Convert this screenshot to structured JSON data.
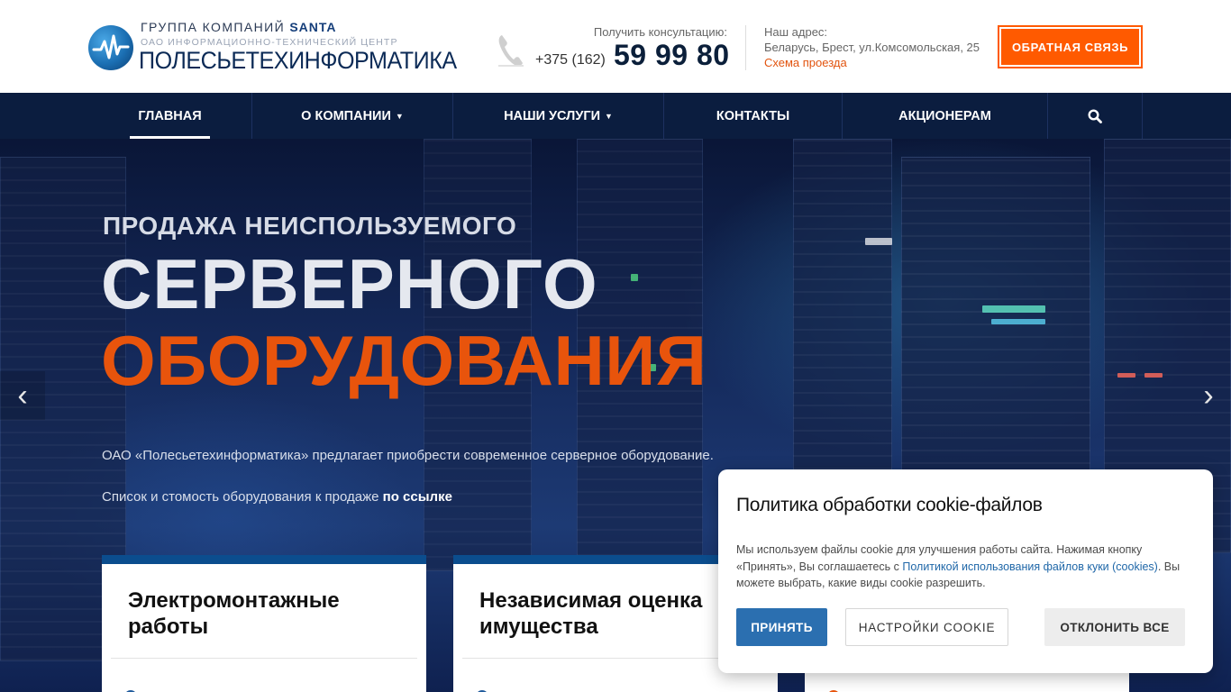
{
  "header": {
    "logo_group_prefix": "ГРУППА КОМПАНИЙ",
    "logo_group_brand": "SANTA",
    "logo_subtitle": "ОАО ИНФОРМАЦИОННО-ТЕХНИЧЕСКИЙ ЦЕНТР",
    "logo_name": "ПОЛЕСЬЕТЕХИНФОРМАТИКА",
    "consult_label": "Получить консультацию:",
    "phone_prefix": "+375 (162)",
    "phone_main": "59 99 80",
    "address_label": "Наш адрес:",
    "address_text": "Беларусь, Брест, ул.Комсомольская, 25",
    "address_link": "Схема проезда",
    "feedback_button": "ОБРАТНАЯ СВЯЗЬ"
  },
  "nav": {
    "items": [
      {
        "label": "ГЛАВНАЯ",
        "active": true
      },
      {
        "label": "О КОМПАНИИ",
        "dropdown": true
      },
      {
        "label": "НАШИ УСЛУГИ",
        "dropdown": true
      },
      {
        "label": "КОНТАКТЫ"
      },
      {
        "label": "АКЦИОНЕРАМ"
      }
    ],
    "search_icon": "search-icon"
  },
  "hero": {
    "line1": "ПРОДАЖА НЕИСПОЛЬЗУЕМОГО",
    "line2": "СЕРВЕРНОГО",
    "line3": "ОБОРУДОВАНИЯ",
    "paragraph1": "ОАО «Полесьетехинформатика» предлагает приобрести современное серверное оборудование.",
    "paragraph2_text": "Список и стомость оборудования к продаже ",
    "paragraph2_link": "по ссылке"
  },
  "cards": [
    {
      "title_line1": "Электромонтажные",
      "title_line2": "работы"
    },
    {
      "title_line1": "Независимая оценка",
      "title_line2": "имущества"
    },
    {
      "title_line1": "",
      "title_line2": ""
    }
  ],
  "cookie": {
    "title": "Политика обработки cookie-файлов",
    "text_before_link": "Мы используем файлы cookie для улучшения работы сайта. Нажимая кнопку «Принять», Вы соглашаетесь с ",
    "link": "Политикой использования файлов куки (cookies)",
    "text_after_link": ". Вы можете выбрать, какие виды cookie разрешить.",
    "accept": "ПРИНЯТЬ",
    "settings": "НАСТРОЙКИ COOKIE",
    "decline": "ОТКЛОНИТЬ ВСЕ"
  },
  "colors": {
    "nav_bg": "#0b1d3f",
    "accent_orange": "#ff5a00",
    "hero_orange": "#e8540c",
    "card_top": "#0b4d8e",
    "accept_blue": "#2b6fb0"
  }
}
